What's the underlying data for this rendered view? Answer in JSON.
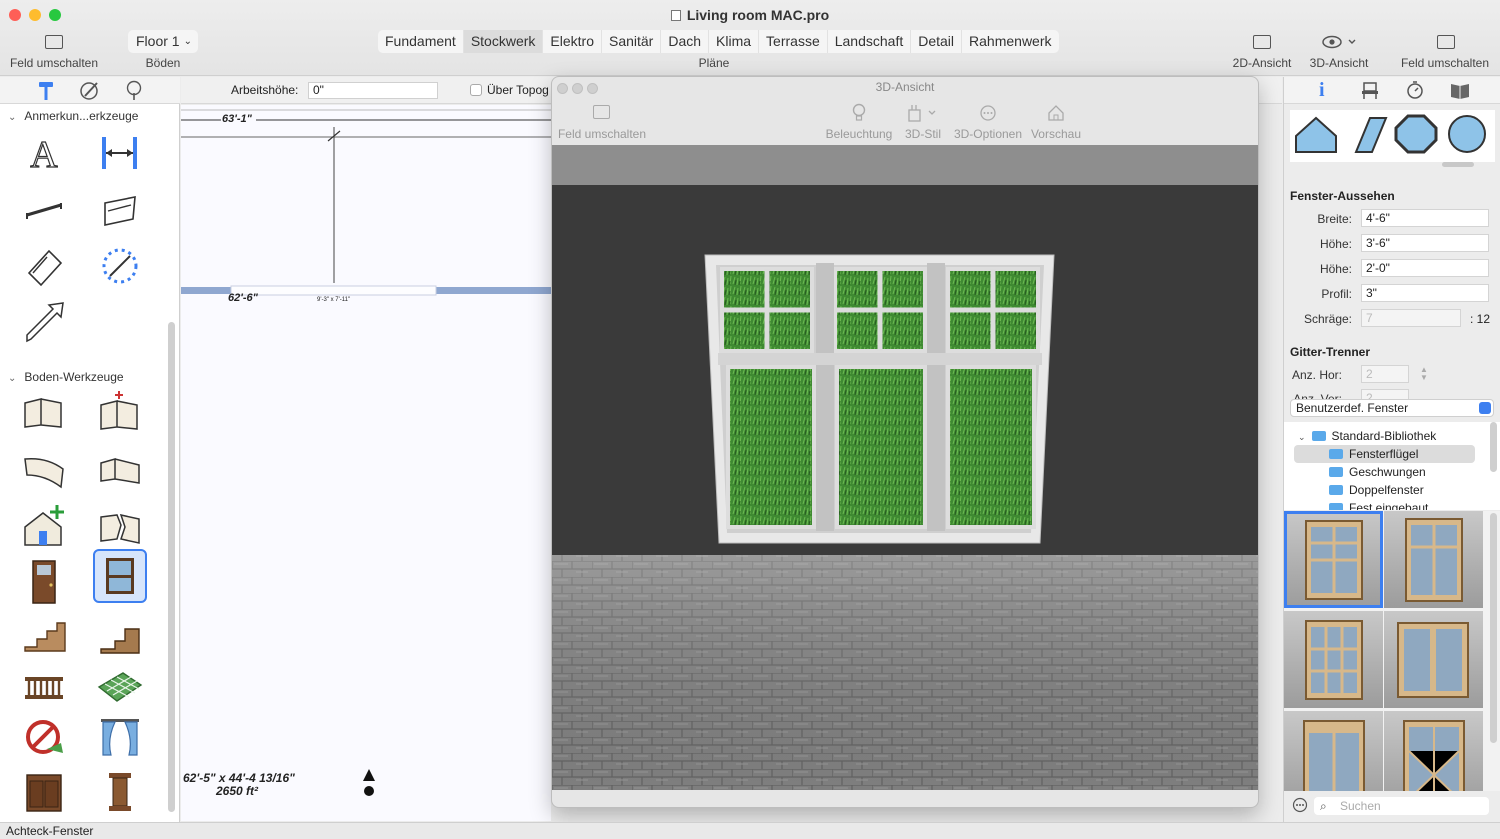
{
  "window": {
    "title": "Living room MAC.pro"
  },
  "toolbar": {
    "left_toggle_label": "Feld umschalten",
    "floor_select_value": "Floor 1",
    "floors_label": "Böden",
    "plans_label": "Pläne",
    "plan_tabs": [
      "Fundament",
      "Stockwerk",
      "Elektro",
      "Sanitär",
      "Dach",
      "Klima",
      "Terrasse",
      "Landschaft",
      "Detail",
      "Rahmenwerk"
    ],
    "active_plan_tab": "Stockwerk",
    "view2d_label": "2D-Ansicht",
    "view3d_label": "3D-Ansicht",
    "right_toggle_label": "Feld umschalten"
  },
  "options_bar": {
    "arbeitshoehe_label": "Arbeitshöhe:",
    "arbeitshoehe_value": "0\"",
    "ueber_topo_label": "Über Topog"
  },
  "left_panel": {
    "section_annotation": "Anmerkun...erkzeuge",
    "section_floor": "Boden-Werkzeuge"
  },
  "plan": {
    "dim_top": "63'-1\"",
    "dim_wall": "62'-6\"",
    "tiny_label": "9'-3\" x 7'-11\"",
    "area_dims": "62'-5\" x 44'-4 13/16\"",
    "area_sqft": "2650 ft²"
  },
  "view3d": {
    "title": "3D-Ansicht",
    "toggle_label": "Feld umschalten",
    "lighting_label": "Beleuchtung",
    "style_label": "3D-Stil",
    "options_label": "3D-Optionen",
    "preview_label": "Vorschau"
  },
  "inspector": {
    "appearance_heading": "Fenster-Aussehen",
    "width_label": "Breite:",
    "width_value": "4'-6\"",
    "height_label": "Höhe:",
    "height_value": "3'-6\"",
    "height2_label": "Höhe:",
    "height2_value": "2'-0\"",
    "profile_label": "Profil:",
    "profile_value": "3\"",
    "slope_label": "Schräge:",
    "slope_value": "7",
    "slope_suffix": ": 12",
    "grid_heading": "Gitter-Trenner",
    "count_hor_label": "Anz. Hor:",
    "count_hor_value": "2",
    "count_ver_label": "Anz. Ver:",
    "count_ver_value": "2",
    "library_select": "Benutzerdef. Fenster",
    "tree": [
      {
        "label": "Standard-Bibliothek",
        "level": 0
      },
      {
        "label": "Fensterflügel",
        "level": 1,
        "selected": true
      },
      {
        "label": "Geschwungen",
        "level": 1
      },
      {
        "label": "Doppelfenster",
        "level": 1
      },
      {
        "label": "Fest eingebaut",
        "level": 1
      }
    ],
    "search_placeholder": "Suchen"
  },
  "status": {
    "text": "Achteck-Fenster"
  },
  "colors": {
    "accent": "#3d7ff0",
    "wall": "#3a3a3a",
    "grass": "#3f8a32",
    "frame": "#e8e8e8"
  }
}
